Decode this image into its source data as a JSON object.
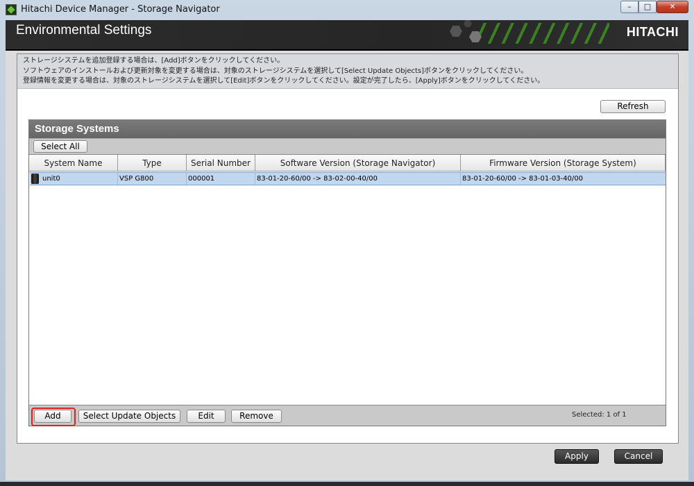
{
  "window": {
    "title": "Hitachi Device Manager - Storage Navigator",
    "controls": {
      "minimize": "–",
      "maximize": "□",
      "close": "✕"
    }
  },
  "header": {
    "title": "Environmental Settings",
    "brand": "HITACHI"
  },
  "instructions": [
    "ストレージシステムを追加登録する場合は、[Add]ボタンをクリックしてください。",
    "ソフトウェアのインストールおよび更新対象を変更する場合は、対象のストレージシステムを選択して[Select Update Objects]ボタンをクリックしてください。",
    "登録情報を変更する場合は、対象のストレージシステムを選択して[Edit]ボタンをクリックしてください。設定が完了したら、[Apply]ボタンをクリックしてください。"
  ],
  "refresh_label": "Refresh",
  "storage_panel": {
    "title": "Storage Systems",
    "select_all_label": "Select All",
    "columns": [
      "System Name",
      "Type",
      "Serial Number",
      "Software Version (Storage Navigator)",
      "Firmware Version (Storage System)"
    ],
    "rows": [
      {
        "system_name": "unit0",
        "type": "VSP G800",
        "serial_number": "000001",
        "software_version": "83-01-20-60/00 -> 83-02-00-40/00",
        "firmware_version": "83-01-20-60/00 -> 83-01-03-40/00",
        "selected": true,
        "icon": "storage-system-icon"
      }
    ],
    "actions": {
      "add": "Add",
      "select_update_objects": "Select Update Objects",
      "edit": "Edit",
      "remove": "Remove"
    },
    "selected_count": "Selected: 1 of 1",
    "highlighted_action": "add"
  },
  "footer": {
    "apply": "Apply",
    "cancel": "Cancel"
  },
  "colors": {
    "header_bg": "#262626",
    "selection_row": "#c2d7ee",
    "highlight_border": "#e02020",
    "accent_green": "#3b8c22"
  }
}
